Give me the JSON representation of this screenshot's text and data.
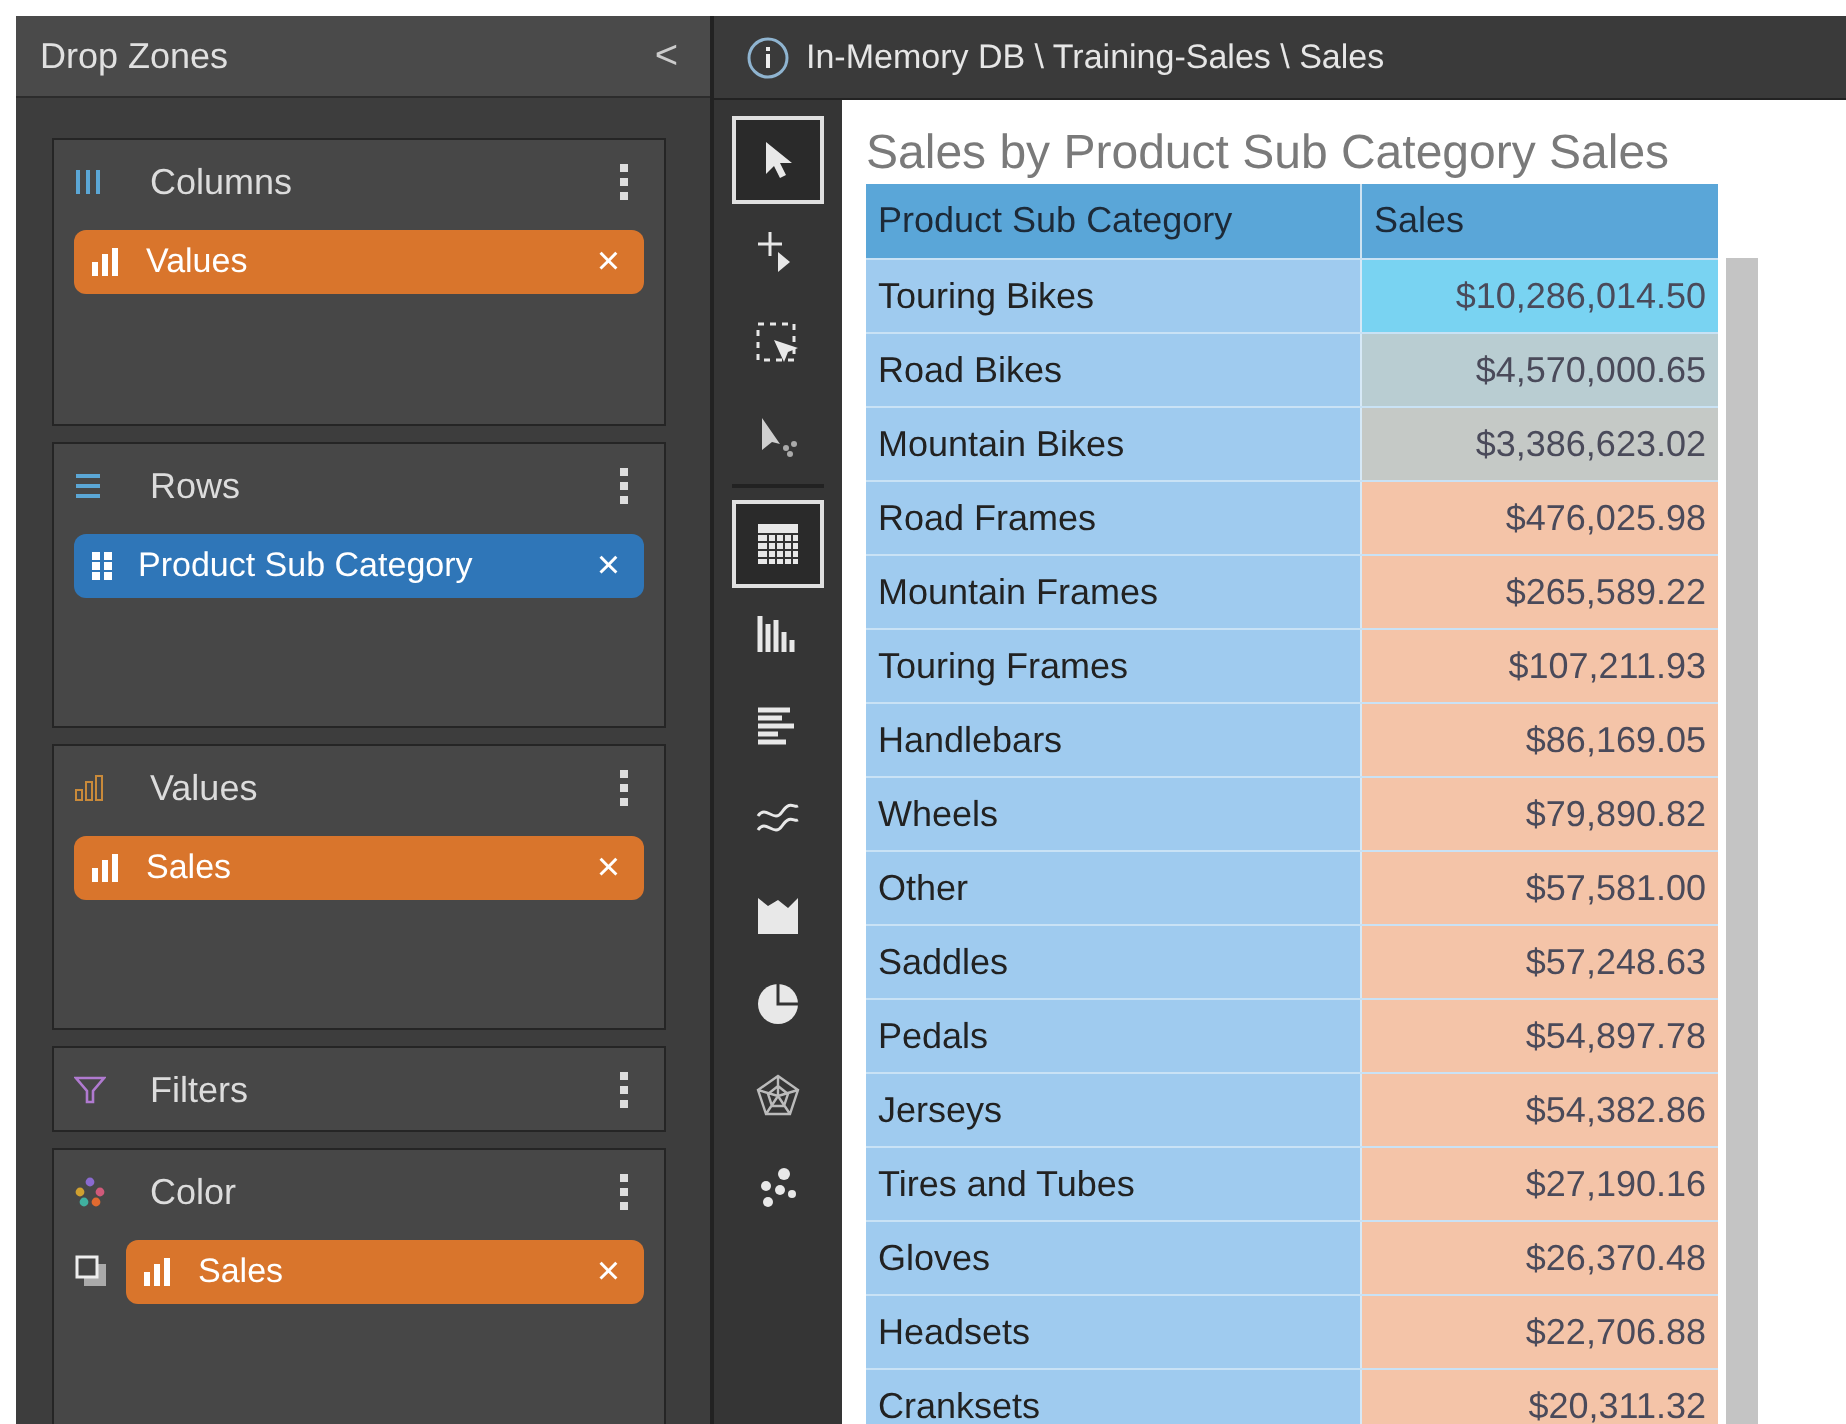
{
  "panel": {
    "title": "Drop Zones",
    "collapse_glyph": "<"
  },
  "zones": [
    {
      "kind": "columns",
      "title": "Columns",
      "pills": [
        {
          "kind": "measure",
          "label": "Values",
          "remove": "×"
        }
      ]
    },
    {
      "kind": "rows",
      "title": "Rows",
      "pills": [
        {
          "kind": "dimension",
          "label": "Product Sub Category",
          "remove": "×"
        }
      ]
    },
    {
      "kind": "values",
      "title": "Values",
      "pills": [
        {
          "kind": "measure",
          "label": "Sales",
          "remove": "×"
        }
      ]
    },
    {
      "kind": "filters",
      "title": "Filters"
    },
    {
      "kind": "color",
      "title": "Color",
      "pills": [
        {
          "kind": "measure",
          "label": "Sales",
          "remove": "×",
          "toggle": true
        }
      ]
    }
  ],
  "breadcrumb": "In-Memory DB \\ Training-Sales \\ Sales",
  "toolbar": [
    {
      "kind": "pointer",
      "selected": true
    },
    {
      "kind": "add",
      "selected": false
    },
    {
      "kind": "select",
      "selected": false
    },
    {
      "kind": "drill",
      "selected": false
    },
    {
      "kind": "table",
      "selected": true
    },
    {
      "kind": "column",
      "selected": false
    },
    {
      "kind": "bar",
      "selected": false
    },
    {
      "kind": "line",
      "selected": false
    },
    {
      "kind": "area",
      "selected": false
    },
    {
      "kind": "pie",
      "selected": false
    },
    {
      "kind": "radar",
      "selected": false
    },
    {
      "kind": "scatter",
      "selected": false
    }
  ],
  "table": {
    "title": "Sales by Product Sub Category Sales",
    "columns": [
      "Product Sub Category",
      "Sales"
    ],
    "rows": [
      {
        "name": "Touring Bikes",
        "sales": "$10,286,014.50",
        "color": "#79d3f2"
      },
      {
        "name": "Road Bikes",
        "sales": "$4,570,000.65",
        "color": "#b9cdd2"
      },
      {
        "name": "Mountain Bikes",
        "sales": "$3,386,623.02",
        "color": "#c5c9c6"
      },
      {
        "name": "Road Frames",
        "sales": "$476,025.98",
        "color": "#f4c4a8"
      },
      {
        "name": "Mountain Frames",
        "sales": "$265,589.22",
        "color": "#f4c4a8"
      },
      {
        "name": "Touring Frames",
        "sales": "$107,211.93",
        "color": "#f4c4a8"
      },
      {
        "name": "Handlebars",
        "sales": "$86,169.05",
        "color": "#f4c4a8"
      },
      {
        "name": "Wheels",
        "sales": "$79,890.82",
        "color": "#f4c4a8"
      },
      {
        "name": "Other",
        "sales": "$57,581.00",
        "color": "#f4c4a8"
      },
      {
        "name": "Saddles",
        "sales": "$57,248.63",
        "color": "#f4c4a8"
      },
      {
        "name": "Pedals",
        "sales": "$54,897.78",
        "color": "#f4c4a8"
      },
      {
        "name": "Jerseys",
        "sales": "$54,382.86",
        "color": "#f4c4a8"
      },
      {
        "name": "Tires and Tubes",
        "sales": "$27,190.16",
        "color": "#f4c4a8"
      },
      {
        "name": "Gloves",
        "sales": "$26,370.48",
        "color": "#f4c4a8"
      },
      {
        "name": "Headsets",
        "sales": "$22,706.88",
        "color": "#f4c4a8"
      },
      {
        "name": "Cranksets",
        "sales": "$20,311.32",
        "color": "#f4c4a8"
      }
    ]
  }
}
